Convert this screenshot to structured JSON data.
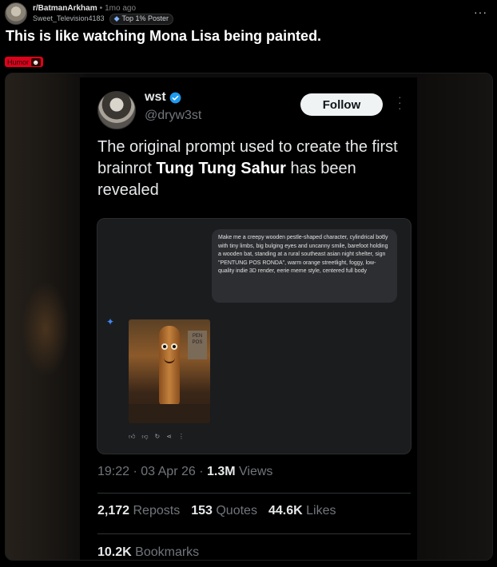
{
  "post": {
    "subreddit": "r/BatmanArkham",
    "time_ago": "1mo ago",
    "author": "Sweet_Television4183",
    "author_badge": "Top 1% Poster",
    "title": "This is like watching Mona Lisa being painted.",
    "flair": "Humor",
    "more_icon": "more-horizontal-icon"
  },
  "tweet": {
    "name": "wst",
    "handle": "@dryw3st",
    "follow_label": "Follow",
    "text_before": "The original prompt used to create the first brainrot ",
    "text_bold": "Tung Tung Sahur",
    "text_after": " has been revealed",
    "chat": {
      "prompt": "Make me a creepy wooden pestle-shaped character, cylindrical body with tiny limbs, big bulging eyes and uncanny smile, barefoot holding a wooden bat, standing at a rural southeast asian night shelter, sign \"PENTUNG POS RONDA\", warm orange streetlight, foggy, low-quality indie 3D render, eerie meme style, centered full body",
      "sign_text": "PEN POS"
    },
    "timestamp": "19:22 · 03 Apr 26 · ",
    "views_count": "1.3M",
    "views_label": " Views",
    "reposts_count": "2,172",
    "reposts_label": "Reposts",
    "quotes_count": "153",
    "quotes_label": "Quotes",
    "likes_count": "44.6K",
    "likes_label": "Likes",
    "bookmarks_count": "10.2K",
    "bookmarks_label": "Bookmarks"
  },
  "colors": {
    "flair_bg": "#e0001b",
    "verified_blue": "#1d9bf0",
    "sparkle_blue": "#4285f4"
  }
}
